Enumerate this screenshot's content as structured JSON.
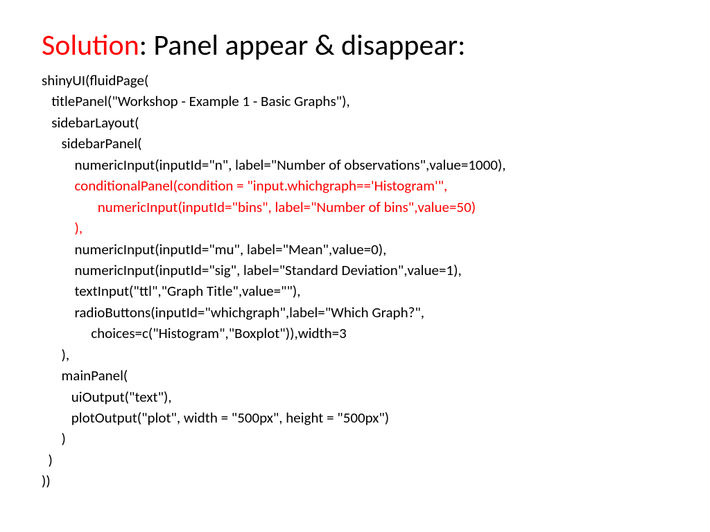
{
  "title": {
    "word1": "Solution",
    "rest": ": Panel appear & disappear:"
  },
  "code": {
    "l1": "shinyUI(fluidPage(",
    "l2": "   titlePanel(\"Workshop - Example 1 - Basic Graphs\"),",
    "l3": "   sidebarLayout(",
    "l4": "      sidebarPanel(",
    "l5": "          numericInput(inputId=\"n\", label=\"Number of observations\",value=1000),",
    "l6": "          conditionalPanel(condition = \"input.whichgraph=='Histogram'\",",
    "l7": "                 numericInput(inputId=\"bins\", label=\"Number of bins\",value=50)",
    "l8": "          ),",
    "l9": "          numericInput(inputId=\"mu\", label=\"Mean\",value=0),",
    "l10": "          numericInput(inputId=\"sig\", label=\"Standard Deviation\",value=1),",
    "l11": "          textInput(\"ttl\",\"Graph Title\",value=\"\"),",
    "l12": "          radioButtons(inputId=\"whichgraph\",label=\"Which Graph?\",",
    "l13": "               choices=c(\"Histogram\",\"Boxplot\")),width=3",
    "l14": "      ),",
    "l15": "      mainPanel(",
    "l16": "         uiOutput(\"text\"),",
    "l17": "         plotOutput(\"plot\", width = \"500px\", height = \"500px\")",
    "l18": "      )",
    "l19": "  )",
    "l20": "))"
  }
}
